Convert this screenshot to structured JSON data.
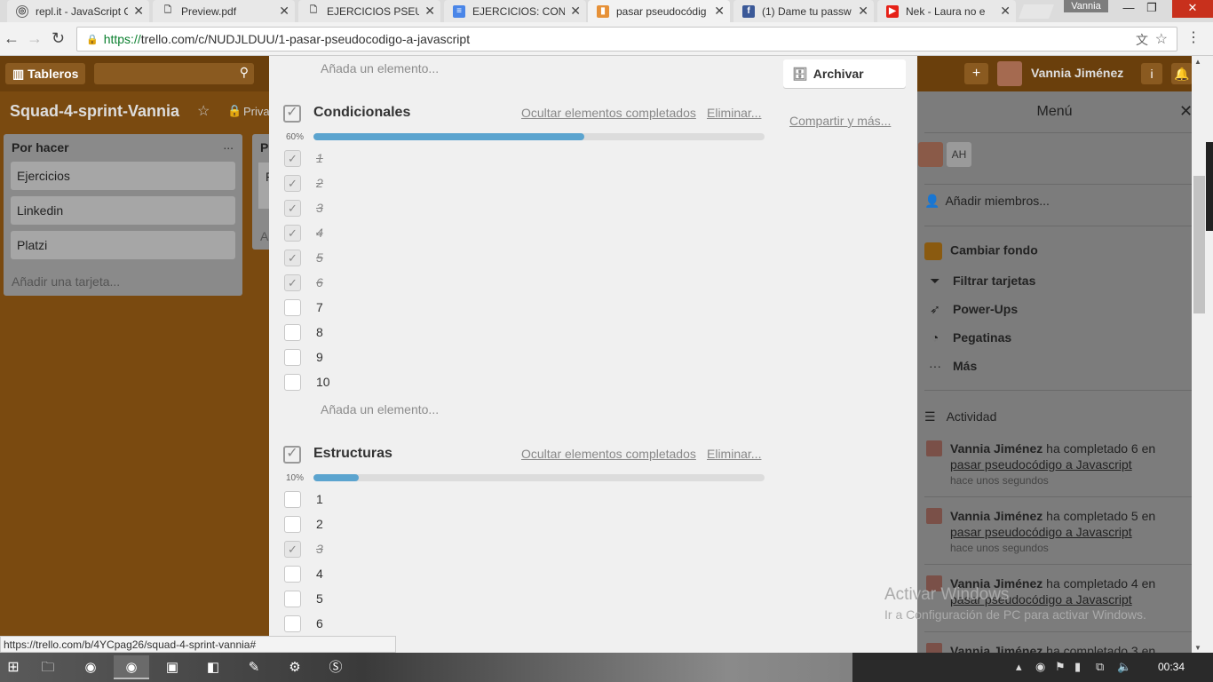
{
  "browser": {
    "tabs": [
      {
        "title": "repl.it - JavaScript O",
        "icon": "repl-icon"
      },
      {
        "title": "Preview.pdf",
        "icon": "document-icon"
      },
      {
        "title": "EJERCICIOS PSEUDO",
        "icon": "document-icon"
      },
      {
        "title": "EJERCICIOS: COND",
        "icon": "docs-icon"
      },
      {
        "title": "pasar pseudocódig",
        "icon": "trello-icon"
      },
      {
        "title": "(1) Dame tu passw",
        "icon": "facebook-icon"
      },
      {
        "title": "Nek - Laura no e",
        "icon": "youtube-icon"
      }
    ],
    "profile_name": "Vannia",
    "url_secure": "https://",
    "url_rest": "trello.com/c/NUDJLDUU/1-pasar-pseudocodigo-a-javascript",
    "status_url": "https://trello.com/b/4YCpag26/squad-4-sprint-vannia#"
  },
  "board": {
    "boards_button": "Tableros",
    "title": "Squad-4-sprint-Vannia",
    "privacy_label": "Priva",
    "lists": [
      {
        "title": "Por hacer",
        "menu": "...",
        "cards": [
          "Ejercicios",
          "Linkedin",
          "Platzi"
        ],
        "add_card": "Añadir una tarjeta..."
      }
    ],
    "list2_partial": {
      "title": "P",
      "card": "P",
      "add": "A"
    }
  },
  "header": {
    "plus": "+",
    "user_name": "Vannia Jiménez",
    "info": "i"
  },
  "card_detail": {
    "add_item_top": "Añada un elemento...",
    "archive_button": "Archivar",
    "share_link": "Compartir y más...",
    "checklists": [
      {
        "title": "Condicionales",
        "hide_completed": "Ocultar elementos completados",
        "delete": "Eliminar...",
        "progress_label": "60%",
        "progress": 0.6,
        "items": [
          {
            "text": "1",
            "done": true
          },
          {
            "text": "2",
            "done": true
          },
          {
            "text": "3",
            "done": true
          },
          {
            "text": "4",
            "done": true
          },
          {
            "text": "5",
            "done": true
          },
          {
            "text": "6",
            "done": true
          },
          {
            "text": "7",
            "done": false
          },
          {
            "text": "8",
            "done": false
          },
          {
            "text": "9",
            "done": false
          },
          {
            "text": "10",
            "done": false
          }
        ],
        "add_item": "Añada un elemento..."
      },
      {
        "title": "Estructuras",
        "hide_completed": "Ocultar elementos completados",
        "delete": "Eliminar...",
        "progress_label": "10%",
        "progress": 0.1,
        "items": [
          {
            "text": "1",
            "done": false
          },
          {
            "text": "2",
            "done": false
          },
          {
            "text": "3",
            "done": true
          },
          {
            "text": "4",
            "done": false
          },
          {
            "text": "5",
            "done": false
          },
          {
            "text": "6",
            "done": false
          }
        ]
      }
    ]
  },
  "menu": {
    "title": "Menú",
    "member_initials": "AH",
    "add_members": "Añadir miembros...",
    "items": [
      {
        "label": "Cambiar fondo",
        "icon": "color-swatch-icon"
      },
      {
        "label": "Filtrar tarjetas",
        "icon": "filter-icon"
      },
      {
        "label": "Power-Ups",
        "icon": "rocket-icon"
      },
      {
        "label": "Pegatinas",
        "icon": "sticker-icon"
      },
      {
        "label": "Más",
        "icon": "more-icon"
      }
    ],
    "activity_title": "Actividad",
    "activity": [
      {
        "user": "Vannia Jiménez",
        "action": " ha completado 6 en ",
        "card": "pasar pseudocódigo a Javascript",
        "time": "hace unos segundos"
      },
      {
        "user": "Vannia Jiménez",
        "action": " ha completado 5 en ",
        "card": "pasar pseudocódigo a Javascript",
        "time": "hace unos segundos"
      },
      {
        "user": "Vannia Jiménez",
        "action": " ha completado 4 en ",
        "card": "pasar pseudocódigo a Javascript",
        "time": ""
      },
      {
        "user": "Vannia Jiménez",
        "action": " ha completado 3 en",
        "card": "",
        "time": ""
      }
    ]
  },
  "watermark": {
    "line1": "Activar Windows",
    "line2": "Ir a Configuración de PC para activar Windows."
  },
  "taskbar": {
    "clock": "00:34"
  }
}
